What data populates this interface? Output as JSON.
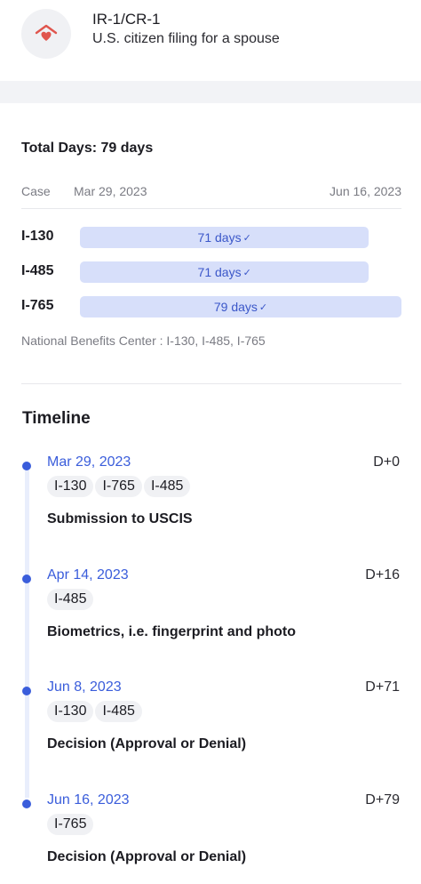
{
  "header": {
    "icon": "home-heart-icon",
    "visa_code": "IR-1/CR-1",
    "visa_description": "U.S. citizen filing for a spouse"
  },
  "summary": {
    "total_days_label": "Total Days: 79 days",
    "case_label": "Case",
    "case_start": "Mar 29, 2023",
    "case_end": "Jun 16, 2023",
    "forms": [
      {
        "name": "I-130",
        "days_label": "71 days",
        "days": 71,
        "completed": true
      },
      {
        "name": "I-485",
        "days_label": "71 days",
        "days": 71,
        "completed": true
      },
      {
        "name": "I-765",
        "days_label": "79 days",
        "days": 79,
        "completed": true
      }
    ],
    "max_days": 79,
    "center_note": "National Benefits Center : I-130, I-485, I-765"
  },
  "timeline": {
    "title": "Timeline",
    "events": [
      {
        "date": "Mar 29, 2023",
        "day": "D+0",
        "forms": [
          "I-130",
          "I-765",
          "I-485"
        ],
        "title": "Submission to USCIS"
      },
      {
        "date": "Apr 14, 2023",
        "day": "D+16",
        "forms": [
          "I-485"
        ],
        "title": "Biometrics, i.e. fingerprint and photo"
      },
      {
        "date": "Jun 8, 2023",
        "day": "D+71",
        "forms": [
          "I-130",
          "I-485"
        ],
        "title": "Decision (Approval or Denial)"
      },
      {
        "date": "Jun 16, 2023",
        "day": "D+79",
        "forms": [
          "I-765"
        ],
        "title": "Decision (Approval or Denial)"
      }
    ]
  },
  "colors": {
    "accent": "#3a5ddb",
    "bar_fill": "#d7dffa",
    "icon_red": "#e0554d"
  }
}
